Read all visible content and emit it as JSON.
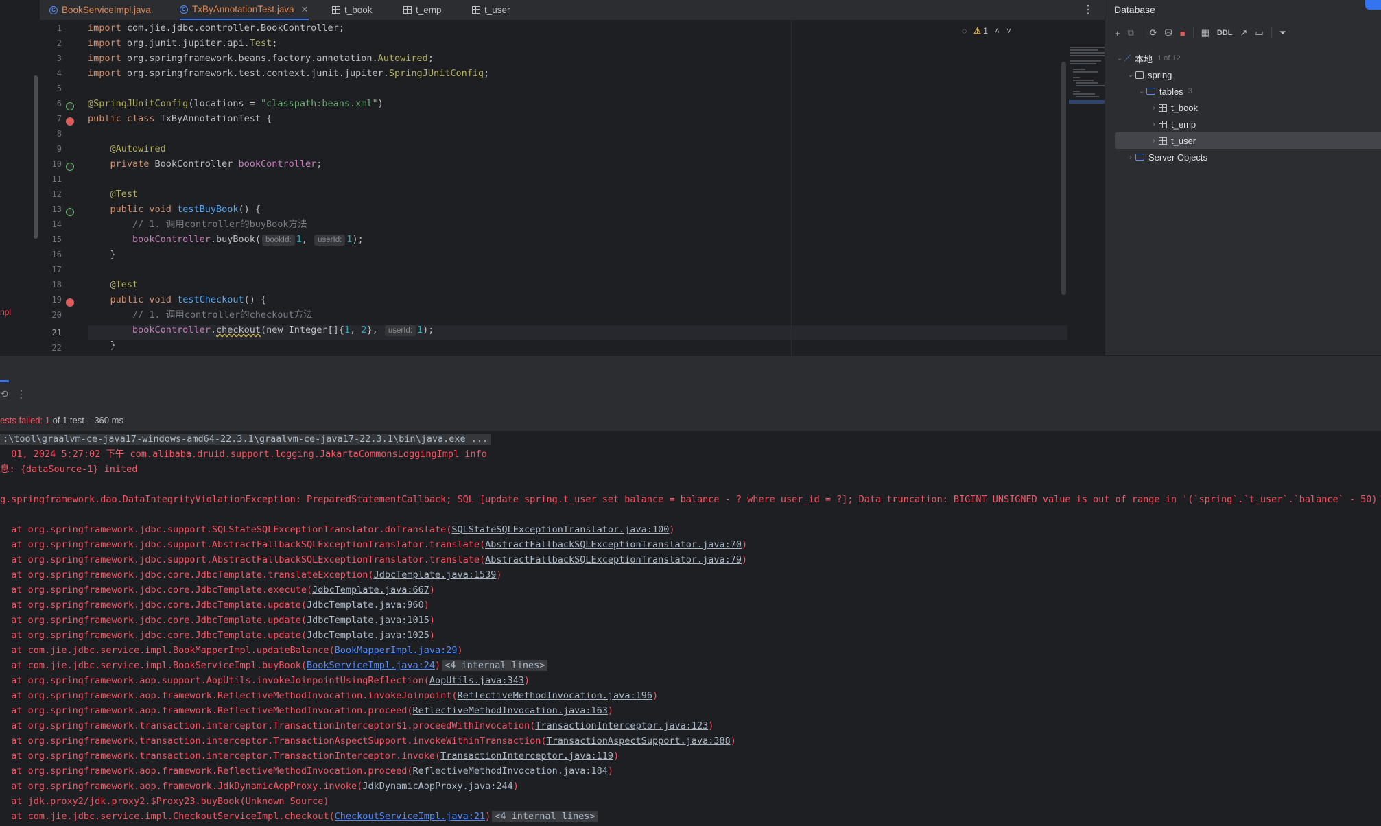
{
  "tabs": [
    {
      "label": "BookServiceImpl.java",
      "icon": "java-class-icon",
      "active": false
    },
    {
      "label": "TxByAnnotationTest.java",
      "icon": "java-class-icon",
      "active": true
    },
    {
      "label": "t_book",
      "icon": "table-icon",
      "active": false
    },
    {
      "label": "t_emp",
      "icon": "table-icon",
      "active": false
    },
    {
      "label": "t_user",
      "icon": "table-icon",
      "active": false
    }
  ],
  "editor": {
    "line_numbers": [
      "1",
      "2",
      "3",
      "4",
      "5",
      "6",
      "7",
      "8",
      "9",
      "10",
      "11",
      "12",
      "13",
      "14",
      "15",
      "16",
      "17",
      "18",
      "19",
      "20",
      "21",
      "22"
    ],
    "current_line": "21",
    "warning_count": "1",
    "lines": {
      "l1": {
        "kw": "import",
        "rest": " com.jie.jdbc.controller.BookController;"
      },
      "l2": {
        "kw": "import",
        "rest": " org.junit.jupiter.api.",
        "an": "Test",
        "end": ";"
      },
      "l3": {
        "kw": "import",
        "rest": " org.springframework.beans.factory.annotation.",
        "an": "Autowired",
        "end": ";"
      },
      "l4": {
        "kw": "import",
        "rest": " org.springframework.test.context.junit.jupiter.",
        "an": "SpringJUnitConfig",
        "end": ";"
      },
      "l6": {
        "an": "@SpringJUnitConfig",
        "mid": "(locations = ",
        "str": "\"classpath:beans.xml\"",
        "end": ")"
      },
      "l7": {
        "kw": "public class",
        "rest": " TxByAnnotationTest {"
      },
      "l9": {
        "an": "@Autowired"
      },
      "l10": {
        "kw": "private",
        "rest": " BookController ",
        "fld": "bookController",
        "end": ";"
      },
      "l12": {
        "an": "@Test"
      },
      "l13": {
        "kw": "public void",
        "fn": "testBuyBook",
        "end": "() {"
      },
      "l14": {
        "cm": "// 1. 调用controller的buyBook方法"
      },
      "l15": {
        "fld": "bookController",
        "call": ".buyBook(",
        "hint1": "bookId:",
        "v1": "1",
        "sep": ", ",
        "hint2": "userId:",
        "v2": "1",
        "end": ");"
      },
      "l16": {
        "rest": "}"
      },
      "l18": {
        "an": "@Test"
      },
      "l19": {
        "kw": "public void",
        "fn": "testCheckout",
        "end": "() {"
      },
      "l20": {
        "cm": "// 1. 调用controller的checkout方法"
      },
      "l21": {
        "fld": "bookController",
        "dot": ".",
        "call": "checkout",
        "mid": "(new Integer[]{",
        "v1": "1",
        "sep": ", ",
        "v2": "2",
        "end1": "}, ",
        "hint": "userId:",
        "v3": "1",
        "end": ");"
      },
      "l22": {
        "rest": "}"
      }
    }
  },
  "database": {
    "title": "Database",
    "toolbar_ddl": "DDL",
    "connection": {
      "label": "本地",
      "badge": "1 of 12"
    },
    "schema": "spring",
    "tables_folder": {
      "label": "tables",
      "count": "3"
    },
    "tables": [
      "t_book",
      "t_emp",
      "t_user"
    ],
    "selected_table": "t_user",
    "server_objects": "Server Objects"
  },
  "run": {
    "status_prefix": "ests failed: ",
    "failed": "1",
    "status_suffix": " of 1 test – 360 ms",
    "cmd": ":\\tool\\graalvm-ce-java17-windows-amd64-22.3.1\\graalvm-ce-java17-22.3.1\\bin\\java.exe ...",
    "log1": "  01, 2024 5:27:02 下午 com.alibaba.druid.support.logging.JakartaCommonsLoggingImpl info",
    "log2": "息: {dataSource-1} inited",
    "exception": "g.springframework.dao.DataIntegrityViolationException: PreparedStatementCallback; SQL [update spring.t_user set balance = balance - ? where user_id = ?]; Data truncation: BIGINT UNSIGNED value is out of range in '(`spring`.`t_user`.`balance` - 50)'",
    "stack": [
      {
        "method": "org.springframework.jdbc.support.SQLStateSQLExceptionTranslator.doTranslate",
        "link": "SQLStateSQLExceptionTranslator.java:100",
        "user": false,
        "folded": ""
      },
      {
        "method": "org.springframework.jdbc.support.AbstractFallbackSQLExceptionTranslator.translate",
        "link": "AbstractFallbackSQLExceptionTranslator.java:70",
        "user": false,
        "folded": ""
      },
      {
        "method": "org.springframework.jdbc.support.AbstractFallbackSQLExceptionTranslator.translate",
        "link": "AbstractFallbackSQLExceptionTranslator.java:79",
        "user": false,
        "folded": ""
      },
      {
        "method": "org.springframework.jdbc.core.JdbcTemplate.translateException",
        "link": "JdbcTemplate.java:1539",
        "user": false,
        "folded": ""
      },
      {
        "method": "org.springframework.jdbc.core.JdbcTemplate.execute",
        "link": "JdbcTemplate.java:667",
        "user": false,
        "folded": ""
      },
      {
        "method": "org.springframework.jdbc.core.JdbcTemplate.update",
        "link": "JdbcTemplate.java:960",
        "user": false,
        "folded": ""
      },
      {
        "method": "org.springframework.jdbc.core.JdbcTemplate.update",
        "link": "JdbcTemplate.java:1015",
        "user": false,
        "folded": ""
      },
      {
        "method": "org.springframework.jdbc.core.JdbcTemplate.update",
        "link": "JdbcTemplate.java:1025",
        "user": false,
        "folded": ""
      },
      {
        "method": "com.jie.jdbc.service.impl.BookMapperImpl.updateBalance",
        "link": "BookMapperImpl.java:29",
        "user": true,
        "folded": ""
      },
      {
        "method": "com.jie.jdbc.service.impl.BookServiceImpl.buyBook",
        "link": "BookServiceImpl.java:24",
        "user": true,
        "folded": "<4 internal lines>"
      },
      {
        "method": "org.springframework.aop.support.AopUtils.invokeJoinpointUsingReflection",
        "link": "AopUtils.java:343",
        "user": false,
        "folded": ""
      },
      {
        "method": "org.springframework.aop.framework.ReflectiveMethodInvocation.invokeJoinpoint",
        "link": "ReflectiveMethodInvocation.java:196",
        "user": false,
        "folded": ""
      },
      {
        "method": "org.springframework.aop.framework.ReflectiveMethodInvocation.proceed",
        "link": "ReflectiveMethodInvocation.java:163",
        "user": false,
        "folded": ""
      },
      {
        "method": "org.springframework.transaction.interceptor.TransactionInterceptor$1.proceedWithInvocation",
        "link": "TransactionInterceptor.java:123",
        "user": false,
        "folded": ""
      },
      {
        "method": "org.springframework.transaction.interceptor.TransactionAspectSupport.invokeWithinTransaction",
        "link": "TransactionAspectSupport.java:388",
        "user": false,
        "folded": ""
      },
      {
        "method": "org.springframework.transaction.interceptor.TransactionInterceptor.invoke",
        "link": "TransactionInterceptor.java:119",
        "user": false,
        "folded": ""
      },
      {
        "method": "org.springframework.aop.framework.ReflectiveMethodInvocation.proceed",
        "link": "ReflectiveMethodInvocation.java:184",
        "user": false,
        "folded": ""
      },
      {
        "method": "org.springframework.aop.framework.JdkDynamicAopProxy.invoke",
        "link": "JdkDynamicAopProxy.java:244",
        "user": false,
        "folded": ""
      },
      {
        "method": "jdk.proxy2/jdk.proxy2.$Proxy23.buyBook",
        "link": "",
        "plain": "(Unknown Source)",
        "user": false,
        "folded": ""
      },
      {
        "method": "com.jie.jdbc.service.impl.CheckoutServiceImpl.checkout",
        "link": "CheckoutServiceImpl.java:21",
        "user": true,
        "folded": "<4 internal lines>"
      }
    ]
  },
  "left_fragment": "npl",
  "colors": {
    "accent": "#3574f0",
    "error": "#f75464",
    "keyword": "#cf8e6d",
    "annotation": "#b3ae60",
    "string": "#6aab73"
  }
}
